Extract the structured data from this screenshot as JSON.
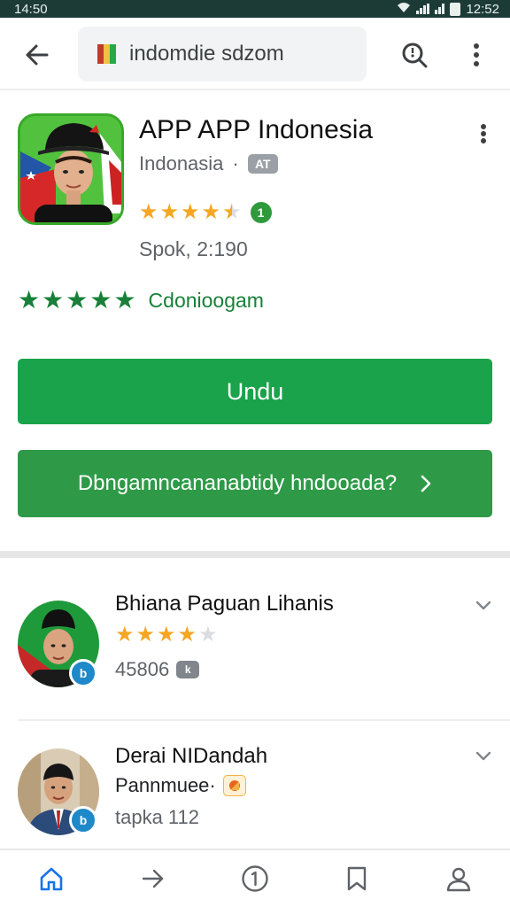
{
  "status_bar": {
    "time_left": "14:50",
    "time_right": "12:52"
  },
  "browser": {
    "url": "indomdie sdzom"
  },
  "app": {
    "title": "APP APP Indonesia",
    "developer": "Indonasia",
    "developer_separator": "·",
    "developer_badge": "AT",
    "rating_stars": 4.5,
    "rating_badge": "1",
    "meta": "Spok, 2:190"
  },
  "green_rating": {
    "stars": 5,
    "text": "Cdonioogam"
  },
  "buttons": {
    "install_label": "Undu",
    "secondary_label": "Dbngamncananabtidy hndooada?"
  },
  "reviews": [
    {
      "name": "Bhiana Paguan Lihanis",
      "stars": 4,
      "meta": "45806",
      "meta_badge": "k",
      "avatar_badge": "b"
    },
    {
      "name": "Derai NIDandah",
      "subtitle": "Pannmuee·",
      "meta": "tapka 112",
      "avatar_badge": "b"
    }
  ],
  "colors": {
    "primary_green": "#1aa34a",
    "secondary_green": "#2e9a47",
    "accent_green_text": "#188038",
    "star_yellow": "#f5a623",
    "status_bar_bg": "#1d3b36"
  },
  "icons": [
    "back-arrow-icon",
    "search-icon",
    "more-vert-icon",
    "home-icon",
    "forward-icon",
    "info-circle-icon",
    "bookmark-icon",
    "profile-icon",
    "chevron-down-icon",
    "chevron-right-icon"
  ]
}
